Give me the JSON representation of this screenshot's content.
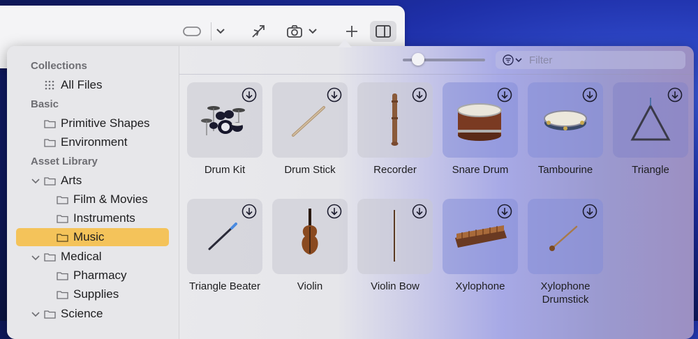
{
  "toolbar": {
    "icons": [
      "vr-headset-icon",
      "chevron-down-icon",
      "share-ar-icon",
      "camera-icon",
      "chevron-down-icon",
      "plus-icon",
      "sidebar-toggle-icon"
    ]
  },
  "sidebar": {
    "collections_header": "Collections",
    "all_files": "All Files",
    "basic_header": "Basic",
    "primitive_shapes": "Primitive Shapes",
    "environment": "Environment",
    "asset_library_header": "Asset Library",
    "arts": "Arts",
    "film_movies": "Film & Movies",
    "instruments": "Instruments",
    "music": "Music",
    "medical": "Medical",
    "pharmacy": "Pharmacy",
    "supplies": "Supplies",
    "science": "Science"
  },
  "browser": {
    "filter_placeholder": "Filter",
    "items": [
      {
        "name": "Drum Kit"
      },
      {
        "name": "Drum Stick"
      },
      {
        "name": "Recorder"
      },
      {
        "name": "Snare Drum"
      },
      {
        "name": "Tambourine"
      },
      {
        "name": "Triangle"
      },
      {
        "name": "Triangle Beater"
      },
      {
        "name": "Violin"
      },
      {
        "name": "Violin Bow"
      },
      {
        "name": "Xylophone"
      },
      {
        "name": "Xylophone Drumstick"
      }
    ]
  },
  "colors": {
    "selection": "#f4c35a",
    "accent_text": "#1d1d1f"
  }
}
